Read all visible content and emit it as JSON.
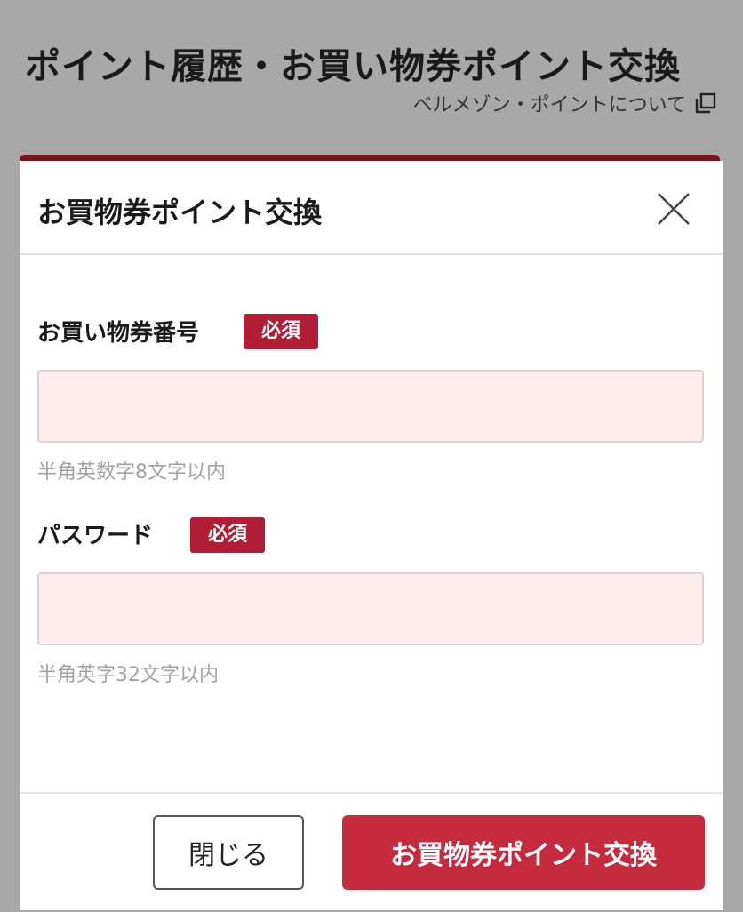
{
  "page": {
    "title": "ポイント履歴・お買い物券ポイント交換",
    "about_link": "ベルメゾン・ポイントについて"
  },
  "modal": {
    "title": "お買物券ポイント交換",
    "fields": [
      {
        "label": "お買い物券番号",
        "badge": "必須",
        "value": "",
        "placeholder": "",
        "hint": "半角英数字8文字以内"
      },
      {
        "label": "パスワード",
        "badge": "必須",
        "value": "",
        "placeholder": "",
        "hint": "半角英字32文字以内"
      }
    ],
    "buttons": {
      "close": "閉じる",
      "submit": "お買物券ポイント交換"
    }
  },
  "colors": {
    "accent": "#c62a3d",
    "badge": "#b01d34",
    "input_bg": "#fdeeee",
    "overlay": "#a8a8a8"
  }
}
